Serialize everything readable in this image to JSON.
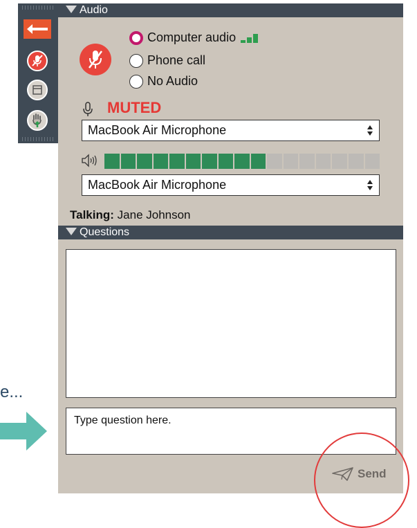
{
  "audio_section": {
    "header": "Audio",
    "options": [
      {
        "label": "Computer audio",
        "selected": true
      },
      {
        "label": "Phone call",
        "selected": false
      },
      {
        "label": "No Audio",
        "selected": false
      }
    ],
    "muted_label": "MUTED",
    "microphone_select": "MacBook Air Microphone",
    "input_level_fraction": 0.59,
    "speaker_select": "MacBook Air Microphone",
    "talking_label": "Talking:",
    "talking_name": "Jane Johnson"
  },
  "questions_section": {
    "header": "Questions",
    "input_text": "Type question here.",
    "send_label": "Send"
  },
  "hint": {
    "text": "e..."
  },
  "colors": {
    "muted_red": "#e53935",
    "mic_button_red": "#e8453c",
    "level_green": "#2e8b57",
    "radio_magenta": "#c2186b",
    "toolbar_bg": "#3f4a55",
    "panel_bg": "#ccc5bb",
    "hint_teal": "#5fbdb0",
    "back_orange": "#e8572f"
  },
  "icons": [
    "back-arrow-icon",
    "muted-mic-icon",
    "window-icon",
    "raise-hand-icon",
    "signal-bars-icon",
    "microphone-icon",
    "speaker-icon",
    "paper-plane-icon"
  ]
}
